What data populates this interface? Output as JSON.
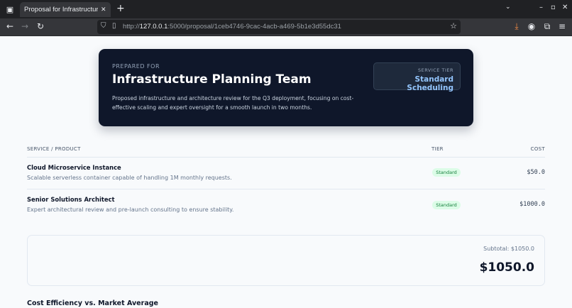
{
  "browser": {
    "tab_title": "Proposal for Infrastructure P",
    "url_prefix": "http://",
    "url_host": "127.0.0.1",
    "url_rest": ":5000/proposal/1ceb4746-9cac-4acb-a469-5b1e3d55dc31"
  },
  "hero": {
    "prepared_label": "PREPARED FOR",
    "client_name": "Infrastructure Planning Team",
    "description": "Proposed infrastructure and architecture review for the Q3 deployment, focusing on cost-effective scaling and expert oversight for a smooth launch in two months.",
    "tier_label": "SERVICE TIER",
    "tier_value": "Standard Scheduling"
  },
  "table": {
    "headers": {
      "service": "SERVICE / PRODUCT",
      "tier": "TIER",
      "cost": "COST"
    },
    "rows": [
      {
        "name": "Cloud Microservice Instance",
        "description": "Scalable serverless container capable of handling 1M monthly requests.",
        "tier": "Standard",
        "cost": "$50.0"
      },
      {
        "name": "Senior Solutions Architect",
        "description": "Expert architectural review and pre-launch consulting to ensure stability.",
        "tier": "Standard",
        "cost": "$1000.0"
      }
    ]
  },
  "summary": {
    "subtotal": "Subtotal: $1050.0",
    "total": "$1050.0"
  },
  "section": {
    "title": "Cost Efficiency vs. Market Average"
  }
}
